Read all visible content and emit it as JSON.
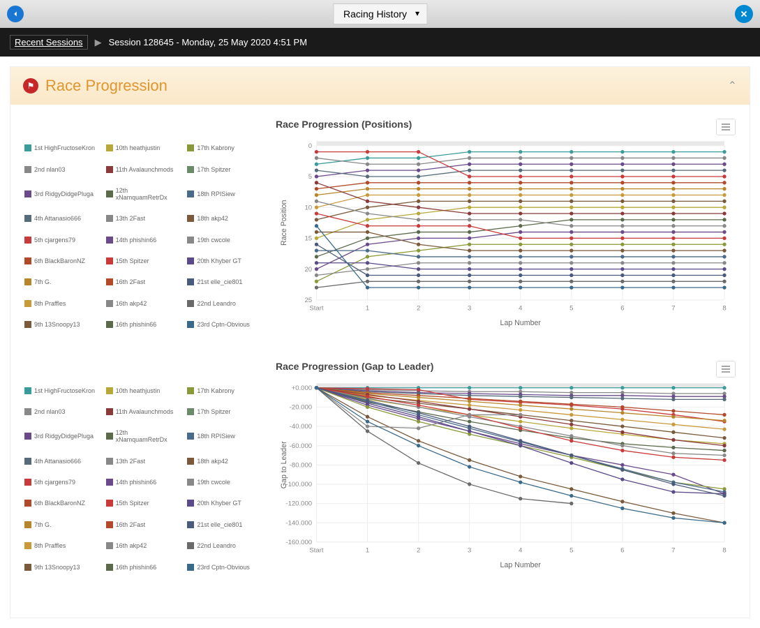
{
  "header": {
    "dropdown_label": "Racing History"
  },
  "breadcrumb": {
    "root": "Recent Sessions",
    "current": "Session 128645 - Monday, 25 May 2020 4:51 PM"
  },
  "section": {
    "title": "Race Progression"
  },
  "drivers": [
    {
      "pos": "1st",
      "name": "HighFructoseKron",
      "color": "#3a9b9b"
    },
    {
      "pos": "2nd",
      "name": "nlan03",
      "color": "#888888"
    },
    {
      "pos": "3rd",
      "name": "RidgyDidgePluga",
      "color": "#6a4a8a"
    },
    {
      "pos": "4th",
      "name": "Attanasio666",
      "color": "#556b7a"
    },
    {
      "pos": "5th",
      "name": "cjargens79",
      "color": "#c93a3a"
    },
    {
      "pos": "6th",
      "name": "BlackBaronNZ",
      "color": "#b24a2a"
    },
    {
      "pos": "7th",
      "name": "G.",
      "color": "#b8862a"
    },
    {
      "pos": "8th",
      "name": "Praffles",
      "color": "#c99a3a"
    },
    {
      "pos": "9th",
      "name": "13Snoopy13",
      "color": "#7a5a3a"
    },
    {
      "pos": "10th",
      "name": "heathjustin",
      "color": "#b8a83a"
    },
    {
      "pos": "11th",
      "name": "Avalaunchmods",
      "color": "#8a3a3a"
    },
    {
      "pos": "12th",
      "name": "xNamquamRetrDx",
      "color": "#5a6a4a"
    },
    {
      "pos": "13th",
      "name": "2Fast",
      "color": "#888888"
    },
    {
      "pos": "14th",
      "name": "phishin66",
      "color": "#6a4a8a"
    },
    {
      "pos": "15th",
      "name": "Spitzer",
      "color": "#c93a3a"
    },
    {
      "pos": "16th",
      "name": "2Fast",
      "color": "#b24a2a"
    },
    {
      "pos": "16th",
      "name": "akp42",
      "color": "#888888"
    },
    {
      "pos": "16th",
      "name": "phishin66",
      "color": "#5a6a4a"
    },
    {
      "pos": "17th",
      "name": "Kabrony",
      "color": "#8a9a3a"
    },
    {
      "pos": "17th",
      "name": "Spitzer",
      "color": "#6a8a6a"
    },
    {
      "pos": "18th",
      "name": "RPISiew",
      "color": "#4a6a8a"
    },
    {
      "pos": "18th",
      "name": "akp42",
      "color": "#7a5a3a"
    },
    {
      "pos": "19th",
      "name": "cwcole",
      "color": "#888888"
    },
    {
      "pos": "20th",
      "name": "Khyber GT",
      "color": "#5a4a8a"
    },
    {
      "pos": "21st",
      "name": "elle_cie801",
      "color": "#4a5a7a"
    },
    {
      "pos": "22nd",
      "name": "Leandro",
      "color": "#6a6a6a"
    },
    {
      "pos": "23rd",
      "name": "Cptn-Obvious",
      "color": "#3a6a8a"
    }
  ],
  "chart_data": [
    {
      "type": "line",
      "title": "Race Progression (Positions)",
      "xlabel": "Lap Number",
      "ylabel": "Race Position",
      "x": [
        "Start",
        1,
        2,
        3,
        4,
        5,
        6,
        7,
        8
      ],
      "ylim": [
        0,
        25
      ],
      "y_inverted": true,
      "y_ticks": [
        0,
        5,
        10,
        15,
        20,
        25
      ],
      "series": [
        {
          "name": "HighFructoseKron",
          "color": "#3a9b9b",
          "values": [
            3,
            2,
            2,
            1,
            1,
            1,
            1,
            1,
            1
          ]
        },
        {
          "name": "nlan03",
          "color": "#888888",
          "values": [
            2,
            3,
            3,
            2,
            2,
            2,
            2,
            2,
            2
          ]
        },
        {
          "name": "RidgyDidgePluga",
          "color": "#6a4a8a",
          "values": [
            5,
            4,
            4,
            3,
            3,
            3,
            3,
            3,
            3
          ]
        },
        {
          "name": "Attanasio666",
          "color": "#556b7a",
          "values": [
            4,
            5,
            5,
            4,
            4,
            4,
            4,
            4,
            4
          ]
        },
        {
          "name": "cjargens79",
          "color": "#c93a3a",
          "values": [
            1,
            1,
            1,
            5,
            5,
            5,
            5,
            5,
            5
          ]
        },
        {
          "name": "BlackBaronNZ",
          "color": "#b24a2a",
          "values": [
            7,
            6,
            6,
            6,
            6,
            6,
            6,
            6,
            6
          ]
        },
        {
          "name": "G.",
          "color": "#b8862a",
          "values": [
            8,
            7,
            7,
            7,
            7,
            7,
            7,
            7,
            7
          ]
        },
        {
          "name": "Praffles",
          "color": "#c99a3a",
          "values": [
            10,
            8,
            8,
            8,
            8,
            8,
            8,
            8,
            8
          ]
        },
        {
          "name": "13Snoopy13",
          "color": "#7a5a3a",
          "values": [
            12,
            10,
            9,
            9,
            9,
            9,
            9,
            9,
            9
          ]
        },
        {
          "name": "heathjustin",
          "color": "#b8a83a",
          "values": [
            15,
            12,
            11,
            10,
            10,
            10,
            10,
            10,
            10
          ]
        },
        {
          "name": "Avalaunchmods",
          "color": "#8a3a3a",
          "values": [
            6,
            9,
            10,
            11,
            11,
            11,
            11,
            11,
            11
          ]
        },
        {
          "name": "xNamquamRetrDx",
          "color": "#5a6a4a",
          "values": [
            18,
            15,
            14,
            14,
            13,
            12,
            12,
            12,
            12
          ]
        },
        {
          "name": "2Fast",
          "color": "#888888",
          "values": [
            9,
            11,
            12,
            12,
            12,
            13,
            13,
            13,
            13
          ]
        },
        {
          "name": "phishin66",
          "color": "#6a4a8a",
          "values": [
            20,
            16,
            15,
            15,
            14,
            14,
            14,
            14,
            14
          ]
        },
        {
          "name": "Spitzer",
          "color": "#c93a3a",
          "values": [
            11,
            13,
            13,
            13,
            15,
            15,
            15,
            15,
            15
          ]
        },
        {
          "name": "Kabrony",
          "color": "#8a9a3a",
          "values": [
            22,
            18,
            17,
            16,
            16,
            16,
            16,
            16,
            16
          ]
        },
        {
          "name": "akp42",
          "color": "#7a5a3a",
          "values": [
            14,
            14,
            16,
            17,
            17,
            17,
            17,
            17,
            17
          ]
        },
        {
          "name": "RPISiew",
          "color": "#4a6a8a",
          "values": [
            17,
            17,
            18,
            18,
            18,
            18,
            18,
            18,
            18
          ]
        },
        {
          "name": "cwcole",
          "color": "#888888",
          "values": [
            21,
            20,
            19,
            19,
            19,
            19,
            19,
            19,
            19
          ]
        },
        {
          "name": "Khyber GT",
          "color": "#5a4a8a",
          "values": [
            19,
            19,
            20,
            20,
            20,
            20,
            20,
            20,
            20
          ]
        },
        {
          "name": "elle_cie801",
          "color": "#4a5a7a",
          "values": [
            16,
            21,
            21,
            21,
            21,
            21,
            21,
            21,
            21
          ]
        },
        {
          "name": "Leandro",
          "color": "#6a6a6a",
          "values": [
            23,
            22,
            22,
            22,
            22,
            22,
            22,
            22,
            22
          ]
        },
        {
          "name": "Cptn-Obvious",
          "color": "#3a6a8a",
          "values": [
            13,
            23,
            23,
            23,
            23,
            23,
            23,
            23,
            23
          ]
        }
      ]
    },
    {
      "type": "line",
      "title": "Race Progression (Gap to Leader)",
      "xlabel": "Lap Number",
      "ylabel": "Gap to Leader",
      "x": [
        "Start",
        1,
        2,
        3,
        4,
        5,
        6,
        7,
        8
      ],
      "ylim": [
        -160000,
        0
      ],
      "y_ticks": [
        0,
        -20000,
        -40000,
        -60000,
        -80000,
        -100000,
        -120000,
        -140000,
        -160000
      ],
      "y_tick_labels": [
        "+0.000",
        "-20.000",
        "-40.000",
        "-60.000",
        "-80.000",
        "-100.000",
        "-120.000",
        "-140.000",
        "-160.000"
      ],
      "series": [
        {
          "name": "HighFructoseKron",
          "color": "#3a9b9b",
          "values": [
            0,
            0,
            0,
            0,
            0,
            0,
            0,
            0,
            0
          ]
        },
        {
          "name": "nlan03",
          "color": "#888888",
          "values": [
            0,
            -2000,
            -3000,
            -4000,
            -4000,
            -5000,
            -5000,
            -6000,
            -6000
          ]
        },
        {
          "name": "RidgyDidgePluga",
          "color": "#6a4a8a",
          "values": [
            0,
            -3000,
            -5000,
            -6000,
            -7000,
            -8000,
            -8000,
            -9000,
            -9000
          ]
        },
        {
          "name": "Attanasio666",
          "color": "#556b7a",
          "values": [
            0,
            -4000,
            -6000,
            -8000,
            -9000,
            -10000,
            -11000,
            -12000,
            -12000
          ]
        },
        {
          "name": "cjargens79",
          "color": "#c93a3a",
          "values": [
            0,
            -1000,
            -2000,
            -12000,
            -15000,
            -18000,
            -22000,
            -28000,
            -35000
          ]
        },
        {
          "name": "BlackBaronNZ",
          "color": "#b24a2a",
          "values": [
            0,
            -5000,
            -8000,
            -11000,
            -14000,
            -17000,
            -20000,
            -24000,
            -28000
          ]
        },
        {
          "name": "G.",
          "color": "#b8862a",
          "values": [
            0,
            -6000,
            -10000,
            -14000,
            -18000,
            -22000,
            -26000,
            -30000,
            -34000
          ]
        },
        {
          "name": "Praffles",
          "color": "#c99a3a",
          "values": [
            0,
            -8000,
            -13000,
            -18000,
            -23000,
            -28000,
            -33000,
            -38000,
            -43000
          ]
        },
        {
          "name": "13Snoopy13",
          "color": "#7a5a3a",
          "values": [
            0,
            -10000,
            -16000,
            -22000,
            -28000,
            -34000,
            -40000,
            -46000,
            -52000
          ]
        },
        {
          "name": "heathjustin",
          "color": "#b8a83a",
          "values": [
            0,
            -12000,
            -20000,
            -28000,
            -35000,
            -42000,
            -48000,
            -54000,
            -58000
          ]
        },
        {
          "name": "Avalaunchmods",
          "color": "#8a3a3a",
          "values": [
            0,
            -7000,
            -14000,
            -22000,
            -30000,
            -38000,
            -46000,
            -54000,
            -60000
          ]
        },
        {
          "name": "xNamquamRetrDx",
          "color": "#5a6a4a",
          "values": [
            0,
            -15000,
            -25000,
            -35000,
            -44000,
            -52000,
            -58000,
            -62000,
            -65000
          ]
        },
        {
          "name": "2Fast",
          "color": "#888888",
          "values": [
            0,
            -11000,
            -20000,
            -30000,
            -40000,
            -50000,
            -60000,
            -68000,
            -70000
          ]
        },
        {
          "name": "phishin66",
          "color": "#6a4a8a",
          "values": [
            0,
            -18000,
            -32000,
            -45000,
            -58000,
            -70000,
            -80000,
            -90000,
            -110000
          ]
        },
        {
          "name": "Spitzer",
          "color": "#c93a3a",
          "values": [
            0,
            -9000,
            -18000,
            -28000,
            -42000,
            -55000,
            -65000,
            -72000,
            -75000
          ]
        },
        {
          "name": "Kabrony",
          "color": "#8a9a3a",
          "values": [
            0,
            -20000,
            -35000,
            -48000,
            -60000,
            -72000,
            -85000,
            -98000,
            -105000
          ]
        },
        {
          "name": "akp42",
          "color": "#7a5a3a",
          "values": [
            0,
            -30000,
            -55000,
            -75000,
            -92000,
            -105000,
            -118000,
            -130000,
            -140000
          ]
        },
        {
          "name": "RPISiew",
          "color": "#4a6a8a",
          "values": [
            0,
            -14000,
            -28000,
            -42000,
            -56000,
            -70000,
            -84000,
            -98000,
            -108000
          ]
        },
        {
          "name": "cwcole",
          "color": "#888888",
          "values": [
            0,
            -40000,
            -42000,
            -28000,
            -28000,
            null,
            null,
            null,
            null
          ]
        },
        {
          "name": "Khyber GT",
          "color": "#5a4a8a",
          "values": [
            0,
            -16000,
            -30000,
            -45000,
            -60000,
            -78000,
            -95000,
            -108000,
            -110000
          ]
        },
        {
          "name": "elle_cie801",
          "color": "#4a5a7a",
          "values": [
            0,
            -13000,
            -26000,
            -40000,
            -55000,
            -70000,
            -85000,
            -100000,
            -112000
          ]
        },
        {
          "name": "Leandro",
          "color": "#6a6a6a",
          "values": [
            0,
            -45000,
            -78000,
            -100000,
            -115000,
            -120000,
            null,
            null,
            null
          ]
        },
        {
          "name": "Cptn-Obvious",
          "color": "#3a6a8a",
          "values": [
            0,
            -35000,
            -60000,
            -82000,
            -98000,
            -112000,
            -125000,
            -135000,
            -140000
          ]
        }
      ]
    }
  ]
}
